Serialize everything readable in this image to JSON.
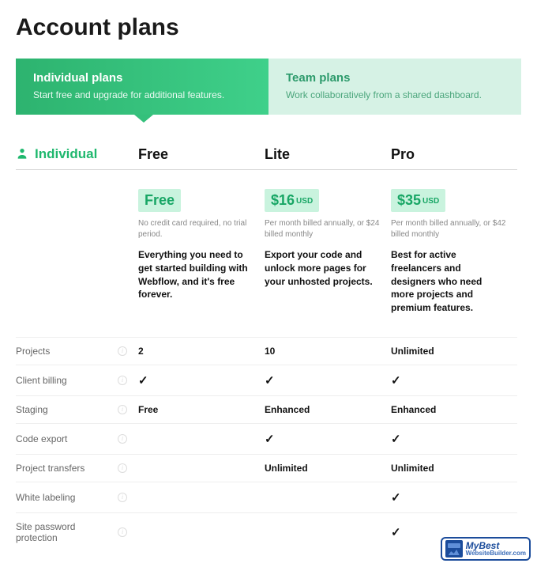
{
  "title": "Account plans",
  "tabs": [
    {
      "title": "Individual plans",
      "subtitle": "Start free and upgrade for additional features."
    },
    {
      "title": "Team plans",
      "subtitle": "Work collaboratively from a shared dashboard."
    }
  ],
  "category_label": "Individual",
  "plans": {
    "free": {
      "name": "Free",
      "price": "Free",
      "currency": "",
      "caption": "No credit card required, no trial period.",
      "desc": "Everything you need to get started building with Webflow, and it's free forever."
    },
    "lite": {
      "name": "Lite",
      "price": "$16",
      "currency": "USD",
      "caption": "Per month billed annually, or $24 billed monthly",
      "desc": "Export your code and unlock more pages for your unhosted projects."
    },
    "pro": {
      "name": "Pro",
      "price": "$35",
      "currency": "USD",
      "caption": "Per month billed annually, or $42 billed monthly",
      "desc": "Best for active freelancers and designers who need more projects and premium features."
    }
  },
  "features": [
    {
      "label": "Projects",
      "free": "2",
      "lite": "10",
      "pro": "Unlimited"
    },
    {
      "label": "Client billing",
      "free": "✓",
      "lite": "✓",
      "pro": "✓"
    },
    {
      "label": "Staging",
      "free": "Free",
      "lite": "Enhanced",
      "pro": "Enhanced"
    },
    {
      "label": "Code export",
      "free": "",
      "lite": "✓",
      "pro": "✓"
    },
    {
      "label": "Project transfers",
      "free": "",
      "lite": "Unlimited",
      "pro": "Unlimited"
    },
    {
      "label": "White labeling",
      "free": "",
      "lite": "",
      "pro": "✓"
    },
    {
      "label": "Site password protection",
      "free": "",
      "lite": "",
      "pro": "✓"
    }
  ],
  "badge": {
    "top": "MyBest",
    "bottom": "WebsiteBuilder.com"
  }
}
